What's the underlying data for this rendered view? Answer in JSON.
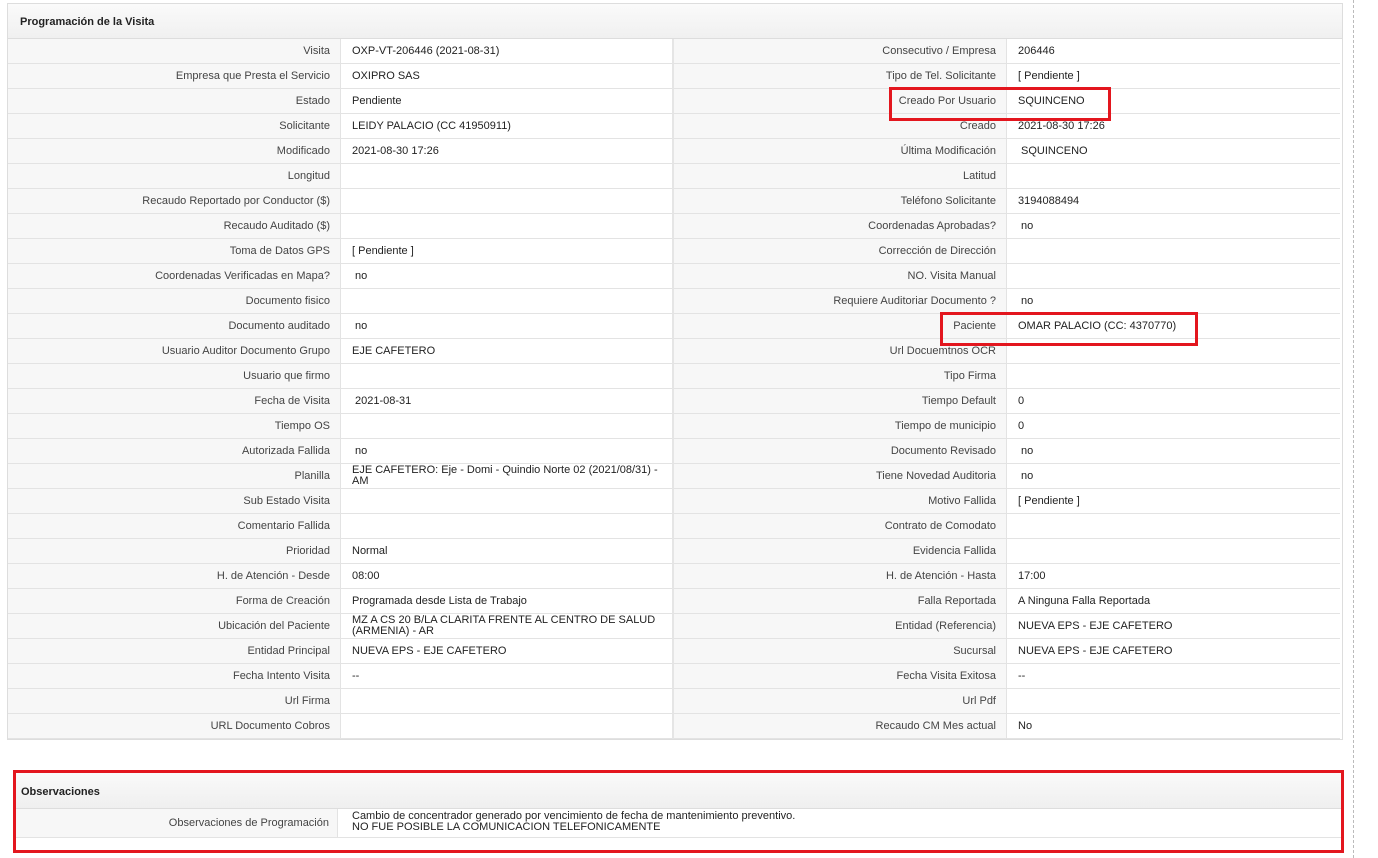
{
  "programacion": {
    "title": "Programación de la Visita",
    "rows": [
      {
        "l1": "Visita",
        "v1": "OXP-VT-206446 (2021-08-31)",
        "l2": "Consecutivo / Empresa",
        "v2": "206446"
      },
      {
        "l1": "Empresa que Presta el Servicio",
        "v1": "OXIPRO SAS",
        "l2": "Tipo de Tel. Solicitante",
        "v2": "[ Pendiente ]"
      },
      {
        "l1": "Estado",
        "v1": "Pendiente",
        "l2": "Creado Por Usuario",
        "v2": "SQUINCENO"
      },
      {
        "l1": "Solicitante",
        "v1": "LEIDY PALACIO (CC 41950911)",
        "l2": "Creado",
        "v2": "2021-08-30 17:26"
      },
      {
        "l1": "Modificado",
        "v1": "2021-08-30 17:26",
        "l2": "Última Modificación",
        "v2": "SQUINCENO"
      },
      {
        "l1": "Longitud",
        "v1": "",
        "l2": "Latitud",
        "v2": ""
      },
      {
        "l1": "Recaudo Reportado por Conductor ($)",
        "v1": "",
        "l2": "Teléfono Solicitante",
        "v2": "3194088494"
      },
      {
        "l1": "Recaudo Auditado ($)",
        "v1": "",
        "l2": "Coordenadas Aprobadas?",
        "v2": "no"
      },
      {
        "l1": "Toma de Datos GPS",
        "v1": "[ Pendiente ]",
        "l2": "Corrección de Dirección",
        "v2": ""
      },
      {
        "l1": "Coordenadas Verificadas en Mapa?",
        "v1": "no",
        "l2": "NO. Visita Manual",
        "v2": ""
      },
      {
        "l1": "Documento fisico",
        "v1": "",
        "l2": "Requiere Auditoriar Documento ?",
        "v2": "no"
      },
      {
        "l1": "Documento auditado",
        "v1": "no",
        "l2": "Paciente",
        "v2": "OMAR PALACIO (CC: 4370770)"
      },
      {
        "l1": "Usuario Auditor Documento Grupo",
        "v1": "EJE CAFETERO",
        "l2": "Url Docuemtnos OCR",
        "v2": ""
      },
      {
        "l1": "Usuario que firmo",
        "v1": "",
        "l2": "Tipo Firma",
        "v2": ""
      },
      {
        "l1": "Fecha de Visita",
        "v1": "2021-08-31",
        "l2": "Tiempo Default",
        "v2": "0"
      },
      {
        "l1": "Tiempo OS",
        "v1": "",
        "l2": "Tiempo de municipio",
        "v2": "0"
      },
      {
        "l1": "Autorizada Fallida",
        "v1": "no",
        "l2": "Documento Revisado",
        "v2": "no"
      },
      {
        "l1": "Planilla",
        "v1": "EJE CAFETERO: Eje - Domi - Quindio Norte 02 (2021/08/31) - AM",
        "l2": "Tiene Novedad Auditoria",
        "v2": "no"
      },
      {
        "l1": "Sub Estado Visita",
        "v1": "",
        "l2": "Motivo Fallida",
        "v2": "[ Pendiente ]"
      },
      {
        "l1": "Comentario Fallida",
        "v1": "",
        "l2": "Contrato de Comodato",
        "v2": ""
      },
      {
        "l1": "Prioridad",
        "v1": "Normal",
        "l2": "Evidencia Fallida",
        "v2": ""
      },
      {
        "l1": "H. de Atención - Desde",
        "v1": "08:00",
        "l2": "H. de Atención - Hasta",
        "v2": "17:00"
      },
      {
        "l1": "Forma de Creación",
        "v1": "Programada desde Lista de Trabajo",
        "l2": "Falla Reportada",
        "v2": "A Ninguna Falla Reportada"
      },
      {
        "l1": "Ubicación del Paciente",
        "v1": "MZ A CS 20 B/LA CLARITA FRENTE AL CENTRO DE SALUD (ARMENIA) - AR",
        "l2": "Entidad (Referencia)",
        "v2": "NUEVA EPS - EJE CAFETERO"
      },
      {
        "l1": "Entidad Principal",
        "v1": "NUEVA EPS - EJE CAFETERO",
        "l2": "Sucursal",
        "v2": "NUEVA EPS - EJE CAFETERO"
      },
      {
        "l1": "Fecha Intento Visita",
        "v1": "--",
        "l2": "Fecha Visita Exitosa",
        "v2": "--"
      },
      {
        "l1": "Url Firma",
        "v1": "",
        "l2": "Url Pdf",
        "v2": ""
      },
      {
        "l1": "URL Documento Cobros",
        "v1": "",
        "l2": "Recaudo CM Mes actual",
        "v2": "No"
      }
    ]
  },
  "observaciones": {
    "title": "Observaciones",
    "label": "Observaciones de Programación",
    "line1": "Cambio de concentrador generado por vencimiento de fecha de mantenimiento preventivo.",
    "line2": "NO FUE POSIBLE LA COMUNICACION TELEFONICAMENTE"
  },
  "colors": {
    "highlight": "#e3161e",
    "label_bg": "#f7f7f7",
    "border": "#e3e3e3"
  }
}
